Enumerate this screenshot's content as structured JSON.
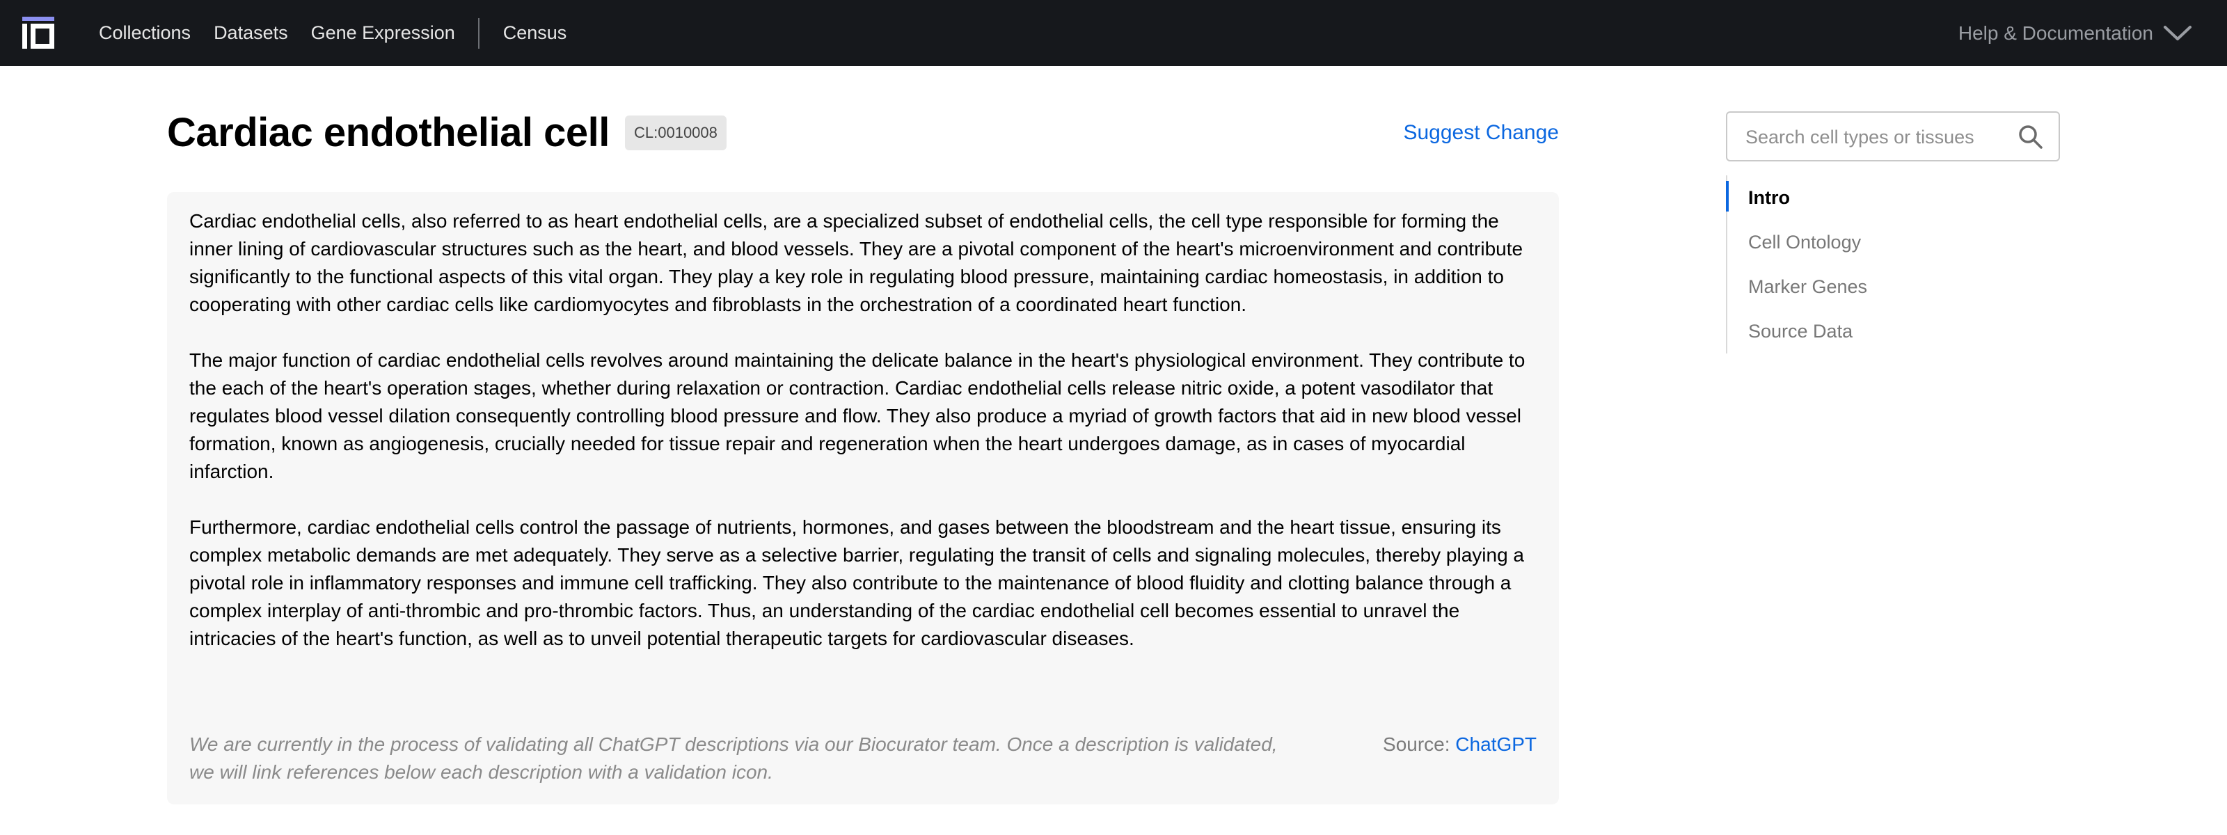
{
  "nav": {
    "items": [
      "Collections",
      "Datasets",
      "Gene Expression",
      "Census"
    ],
    "help_label": "Help & Documentation"
  },
  "header": {
    "title": "Cardiac endothelial cell",
    "ontology_id": "CL:0010008",
    "suggest_change_label": "Suggest Change"
  },
  "description": {
    "paragraphs": [
      "Cardiac endothelial cells, also referred to as heart endothelial cells, are a specialized subset of endothelial cells, the cell type responsible for forming the inner lining of cardiovascular structures such as the heart, and blood vessels. They are a pivotal component of the heart's microenvironment and contribute significantly to the functional aspects of this vital organ. They play a key role in regulating blood pressure, maintaining cardiac homeostasis, in addition to cooperating with other cardiac cells like cardiomyocytes and fibroblasts in the orchestration of a coordinated heart function.",
      "The major function of cardiac endothelial cells revolves around maintaining the delicate balance in the heart's physiological environment. They contribute to the each of the heart's operation stages, whether during relaxation or contraction. Cardiac endothelial cells release nitric oxide, a potent vasodilator that regulates blood vessel dilation consequently controlling blood pressure and flow. They also produce a myriad of growth factors that aid in new blood vessel formation, known as angiogenesis, crucially needed for tissue repair and regeneration when the heart undergoes damage, as in cases of myocardial infarction.",
      "Furthermore, cardiac endothelial cells control the passage of nutrients, hormones, and gases between the bloodstream and the heart tissue, ensuring its complex metabolic demands are met adequately. They serve as a selective barrier, regulating the transit of cells and signaling molecules, thereby playing a pivotal role in inflammatory responses and immune cell trafficking. They also contribute to the maintenance of blood fluidity and clotting balance through a complex interplay of anti-thrombic and pro-thrombic factors. Thus, an understanding of the cardiac endothelial cell becomes essential to unravel the intricacies of the heart's function, as well as to unveil potential therapeutic targets for cardiovascular diseases."
    ],
    "disclaimer": "We are currently in the process of validating all ChatGPT descriptions via our Biocurator team. Once a description is validated, we will link references below each description with a validation icon.",
    "source_label": "Source:",
    "source_link": "ChatGPT"
  },
  "search": {
    "placeholder": "Search cell types or tissues",
    "value": ""
  },
  "toc": {
    "items": [
      "Intro",
      "Cell Ontology",
      "Marker Genes",
      "Source Data"
    ],
    "active": "Intro"
  },
  "colors": {
    "topbar_bg": "#16181c",
    "accent": "#0b67e0",
    "card_bg": "#f7f7f7"
  }
}
